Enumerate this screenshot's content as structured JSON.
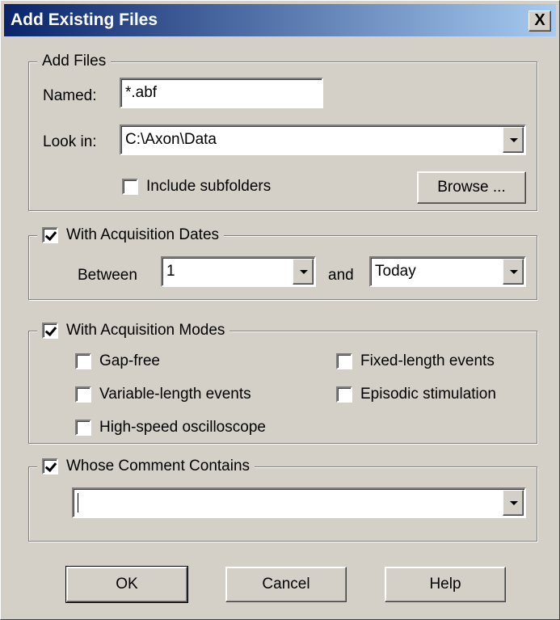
{
  "window": {
    "title": "Add Existing Files",
    "close_glyph": "X"
  },
  "add_files": {
    "legend": "Add Files",
    "named_label": "Named:",
    "named_value": "*.abf",
    "look_in_label": "Look in:",
    "look_in_value": "C:\\Axon\\Data",
    "include_subfolders_label": "Include subfolders",
    "include_subfolders_checked": false,
    "browse_label": "Browse ..."
  },
  "acquisition_dates": {
    "legend": "With Acquisition Dates",
    "checked": true,
    "between_label": "Between",
    "from_value": "1",
    "and_label": "and",
    "to_value": "Today"
  },
  "acquisition_modes": {
    "legend": "With Acquisition Modes",
    "checked": true,
    "options": [
      {
        "label": "Gap-free",
        "checked": false
      },
      {
        "label": "Fixed-length events",
        "checked": false
      },
      {
        "label": "Variable-length events",
        "checked": false
      },
      {
        "label": "Episodic stimulation",
        "checked": false
      },
      {
        "label": "High-speed oscilloscope",
        "checked": false
      }
    ]
  },
  "comment": {
    "legend": "Whose Comment Contains",
    "checked": true,
    "value": ""
  },
  "buttons": {
    "ok": "OK",
    "cancel": "Cancel",
    "help": "Help"
  },
  "colors": {
    "titlebar_start": "#0a246a",
    "titlebar_end": "#a6caf0",
    "face": "#d4d0c8"
  }
}
